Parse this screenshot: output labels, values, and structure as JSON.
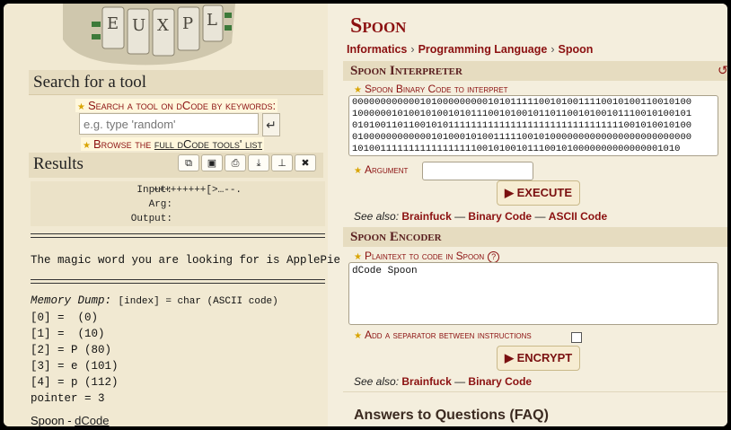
{
  "left": {
    "search_title": "Search for a tool",
    "keywords_label": "Search a tool on dCode by keywords:",
    "search_placeholder": "e.g. type 'random'",
    "search_go_icon": "↵",
    "browse_prefix": "Browse the",
    "browse_link": "full dCode tools' list",
    "results_title": "Results",
    "toolbar_icons": [
      "copy-icon",
      "save-icon",
      "print-icon",
      "download-icon",
      "pin-icon",
      "close-icon"
    ],
    "io": {
      "input_label": "Input:",
      "input_value": "+++++++++[>…--.",
      "arg_label": "Arg:",
      "output_label": "Output:"
    },
    "result_text": "The magic word you are looking for is ApplePie",
    "memory_title": "Memory Dump:",
    "memory_hint": "[index] = char (ASCII code)",
    "memory_rows": [
      "[0] =  (0)",
      "[1] =  (10)",
      "[2] = P (80)",
      "[3] = e (101)",
      "[4] = p (112)"
    ],
    "pointer": "pointer = 3",
    "footer_prefix": "Spoon -",
    "footer_link": "dCode"
  },
  "right": {
    "title": "Spoon",
    "breadcrumb": [
      "Informatics",
      "Programming Language",
      "Spoon"
    ],
    "interpreter": {
      "heading": "Spoon Interpreter",
      "code_label": "Spoon Binary Code to interpret",
      "code_value": "000000000000101000000000101011111001010011110010100110010100\n100000010100101001010111001010010110110010100101110010100101\n010100110110010101111111111111111111111111111111001010010100\n010000000000001010001010011111001010000000000000000000000000\n1010011111111111111111001010010111001010000000000000001010",
      "argument_label": "Argument",
      "execute_label": "▶ EXECUTE",
      "see_also_label": "See also:",
      "see_also": [
        "Brainfuck",
        "Binary Code",
        "ASCII Code"
      ]
    },
    "encoder": {
      "heading": "Spoon Encoder",
      "plaintext_label": "Plaintext to code in Spoon",
      "plaintext_value": "dCode Spoon",
      "separator_label": "Add a separator between instructions",
      "encrypt_label": "▶ ENCRYPT",
      "see_also_label": "See also:",
      "see_also": [
        "Brainfuck",
        "Binary Code"
      ]
    },
    "faq_heading": "Answers to Questions (FAQ)"
  }
}
